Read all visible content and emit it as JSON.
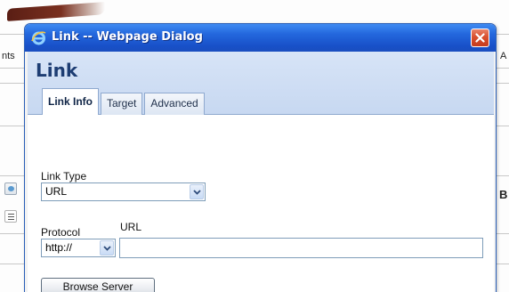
{
  "background": {
    "left_toolbar_text": "nts",
    "right_toolbar_text": "A",
    "right_bold_char": "B"
  },
  "dialog": {
    "window_title": "Link -- Webpage Dialog",
    "heading": "Link",
    "tabs": [
      {
        "label": "Link Info",
        "active": true
      },
      {
        "label": "Target",
        "active": false
      },
      {
        "label": "Advanced",
        "active": false
      }
    ],
    "link_type": {
      "label": "Link Type",
      "value": "URL"
    },
    "protocol": {
      "label": "Protocol",
      "value": "http://"
    },
    "url": {
      "label": "URL",
      "value": ""
    },
    "browse_button_label": "Browse Server"
  },
  "icons": {
    "app_icon": "ie-icon",
    "close": "close-icon",
    "dropdown": "chevron-down-icon"
  },
  "colors": {
    "titlebar": "#2468de",
    "close_button": "#d9502f",
    "heading_text": "#1d3d73",
    "header_background": "#d7e4f7"
  }
}
